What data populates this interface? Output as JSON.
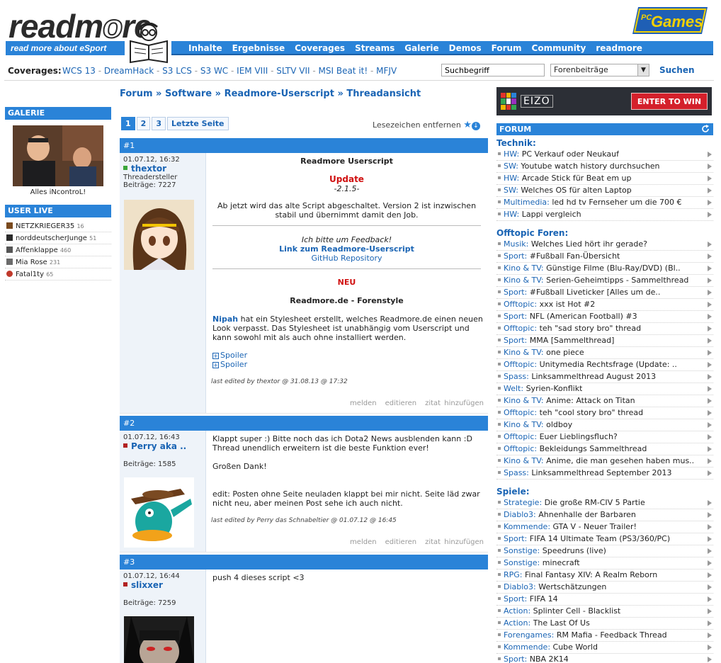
{
  "header": {
    "logo_text_a": "readm",
    "logo_text_o": "o",
    "logo_text_b": "re",
    "tagline": "read more about eSport",
    "nav": [
      "Inhalte",
      "Ergebnisse",
      "Coverages",
      "Streams",
      "Galerie",
      "Demos",
      "Forum",
      "Community",
      "readmore"
    ],
    "partner": "Games",
    "partner_prefix": "PC"
  },
  "coverages": {
    "label": "Coverages:",
    "items": [
      "WCS 13",
      "DreamHack",
      "S3 LCS",
      "S3 WC",
      "IEM VIII",
      "SLTV VII",
      "MSI Beat it!",
      "MFJV"
    ]
  },
  "search": {
    "value": "Suchbegriff",
    "select_value": "Forenbeiträge",
    "button": "Suchen"
  },
  "left": {
    "gallery_title": "GALERIE",
    "gallery_caption": "Alles iNcontroL!",
    "userlive_title": "USER LIVE",
    "users": [
      {
        "name": "NETZKRIEGER35",
        "count": "16",
        "color": "#7a4a1e"
      },
      {
        "name": "norddeutscherJunge",
        "count": "51",
        "color": "#2a2a2a"
      },
      {
        "name": "Affenklappe",
        "count": "460",
        "color": "#555555"
      },
      {
        "name": "Mia Rose",
        "count": "231",
        "color": "#6b6b6b"
      },
      {
        "name": "Fatal1ty",
        "count": "65",
        "color": "#c0392b"
      }
    ]
  },
  "breadcrumb": "Forum » Software » Readmore-Userscript » Threadansicht",
  "pager": {
    "pages": [
      "1",
      "2",
      "3"
    ],
    "last": "Letzte Seite"
  },
  "bookmark": "Lesezeichen entfernen",
  "posts": [
    {
      "num": "#1",
      "date": "01.07.12, 16:32",
      "user": "thextor",
      "status_color": "#3aa53a",
      "role": "Threadersteller",
      "count": "Beiträge: 7227",
      "title": "Readmore Userscript",
      "update_label": "Update",
      "version": "-2.1.5-",
      "para1": "Ab jetzt wird das alte Script abgeschaltet. Version 2 ist inzwischen stabil und übernimmt damit den Job.",
      "feedback": "Ich bitte um Feedback!",
      "link1": "Link zum Readmore-Userscript",
      "link2": "GitHub Repository",
      "neu_label": "NEU",
      "subtitle": "Readmore.de - Forenstyle",
      "para2_user": "Nipah",
      "para2": " hat ein Stylesheet erstellt, welches Readmore.de einen neuen Look verpasst. Das Stylesheet ist unabhängig vom Userscript und kann sowohl mit als auch ohne installiert werden.",
      "spoiler": "Spoiler",
      "edit": "last edited by thextor @ 31.08.13 @ 17:32"
    },
    {
      "num": "#2",
      "date": "01.07.12, 16:43",
      "user": "Perry aka ..",
      "status_color": "#b22222",
      "count": "Beiträge: 1585",
      "text1": "Klappt super :) Bitte noch das ich Dota2 News ausblenden kann :D Thread unendlich erweitern ist die beste Funktion ever!",
      "text2": "Großen Dank!",
      "text3": "edit: Posten ohne Seite neuladen klappt bei mir nicht. Seite läd zwar nicht neu, aber meinen Post sehe ich auch nicht.",
      "edit": "last edited by Perry das Schnabeltier @ 01.07.12 @ 16:45"
    },
    {
      "num": "#3",
      "date": "01.07.12, 16:44",
      "user": "slixxer",
      "status_color": "#b22222",
      "count": "Beiträge: 7259",
      "text1": "push 4 dieses script <3"
    }
  ],
  "post_actions": [
    "melden",
    "editieren",
    "zitat hinzufügen"
  ],
  "right": {
    "ad_brand": "EIZO",
    "ad_button": "ENTER TO WIN",
    "forum_title": "FORUM",
    "sections": [
      {
        "title": "Technik:",
        "items": [
          [
            "HW:",
            "PC Verkauf oder Neukauf"
          ],
          [
            "SW:",
            "Youtube watch history durchsuchen"
          ],
          [
            "HW:",
            "Arcade Stick für Beat em up"
          ],
          [
            "SW:",
            "Welches OS für alten Laptop"
          ],
          [
            "Multimedia:",
            "led hd tv Fernseher um die 700 €"
          ],
          [
            "HW:",
            "Lappi vergleich"
          ]
        ]
      },
      {
        "title": "Offtopic Foren:",
        "items": [
          [
            "Musik:",
            "Welches Lied hört ihr gerade?"
          ],
          [
            "Sport:",
            "#Fußball Fan-Übersicht"
          ],
          [
            "Kino & TV:",
            "Günstige Filme (Blu-Ray/DVD) (Bl.."
          ],
          [
            "Kino & TV:",
            "Serien-Geheimtipps - Sammelthread"
          ],
          [
            "Sport:",
            "#Fußball Liveticker [Alles um de.."
          ],
          [
            "Offtopic:",
            "xxx ist Hot #2"
          ],
          [
            "Sport:",
            "NFL (American Football) #3"
          ],
          [
            "Offtopic:",
            "teh \"sad story bro\" thread"
          ],
          [
            "Sport:",
            "MMA [Sammelthread]"
          ],
          [
            "Kino & TV:",
            "one piece"
          ],
          [
            "Offtopic:",
            "Unitymedia Rechtsfrage (Update: .."
          ],
          [
            "Spass:",
            "Linksammelthread August 2013"
          ],
          [
            "Welt:",
            "Syrien-Konflikt"
          ],
          [
            "Kino & TV:",
            "Anime: Attack on Titan"
          ],
          [
            "Offtopic:",
            "teh \"cool story bro\" thread"
          ],
          [
            "Kino & TV:",
            "oldboy"
          ],
          [
            "Offtopic:",
            "Euer Lieblingsfluch?"
          ],
          [
            "Offtopic:",
            "Bekleidungs Sammelthread"
          ],
          [
            "Kino & TV:",
            "Anime, die man gesehen haben mus.."
          ],
          [
            "Spass:",
            "Linksammelthread September 2013"
          ]
        ]
      },
      {
        "title": "Spiele:",
        "items": [
          [
            "Strategie:",
            "Die große RM-CIV 5 Partie"
          ],
          [
            "Diablo3:",
            "Ahnenhalle der Barbaren"
          ],
          [
            "Kommende:",
            "GTA V - Neuer Trailer!"
          ],
          [
            "Sport:",
            "FIFA 14 Ultimate Team (PS3/360/PC)"
          ],
          [
            "Sonstige:",
            "Speedruns (live)"
          ],
          [
            "Sonstige:",
            "minecraft"
          ],
          [
            "RPG:",
            "Final Fantasy XIV: A Realm Reborn"
          ],
          [
            "Diablo3:",
            "Wertschätzungen"
          ],
          [
            "Sport:",
            "FIFA 14"
          ],
          [
            "Action:",
            "Splinter Cell - Blacklist"
          ],
          [
            "Action:",
            "The Last Of Us"
          ],
          [
            "Forengames:",
            "RM Mafia - Feedback Thread"
          ],
          [
            "Kommende:",
            "Cube World"
          ],
          [
            "Sport:",
            "NBA 2K14"
          ]
        ]
      }
    ]
  }
}
